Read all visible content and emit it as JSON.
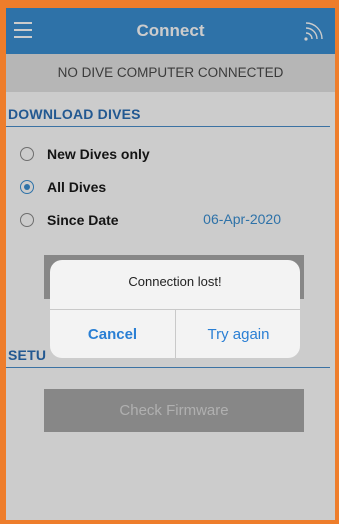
{
  "header": {
    "title": "Connect",
    "menu_icon": "hamburger-menu-icon",
    "signal_icon": "wireless-signal-icon"
  },
  "status": {
    "text": "NO DIVE COMPUTER CONNECTED"
  },
  "download": {
    "title": "DOWNLOAD DIVES",
    "options": [
      {
        "label": "New Dives only",
        "selected": false
      },
      {
        "label": "All Dives",
        "selected": true
      },
      {
        "label": "Since Date",
        "selected": false
      }
    ],
    "since_date": "06-Apr-2020"
  },
  "setup": {
    "title_partial": "SETU"
  },
  "buttons": {
    "check_firmware": "Check Firmware"
  },
  "dialog": {
    "message": "Connection lost!",
    "cancel": "Cancel",
    "retry": "Try again"
  },
  "colors": {
    "accent": "#3a8fd3",
    "frame": "#ee7d2b",
    "header": "#3a8fd3"
  }
}
